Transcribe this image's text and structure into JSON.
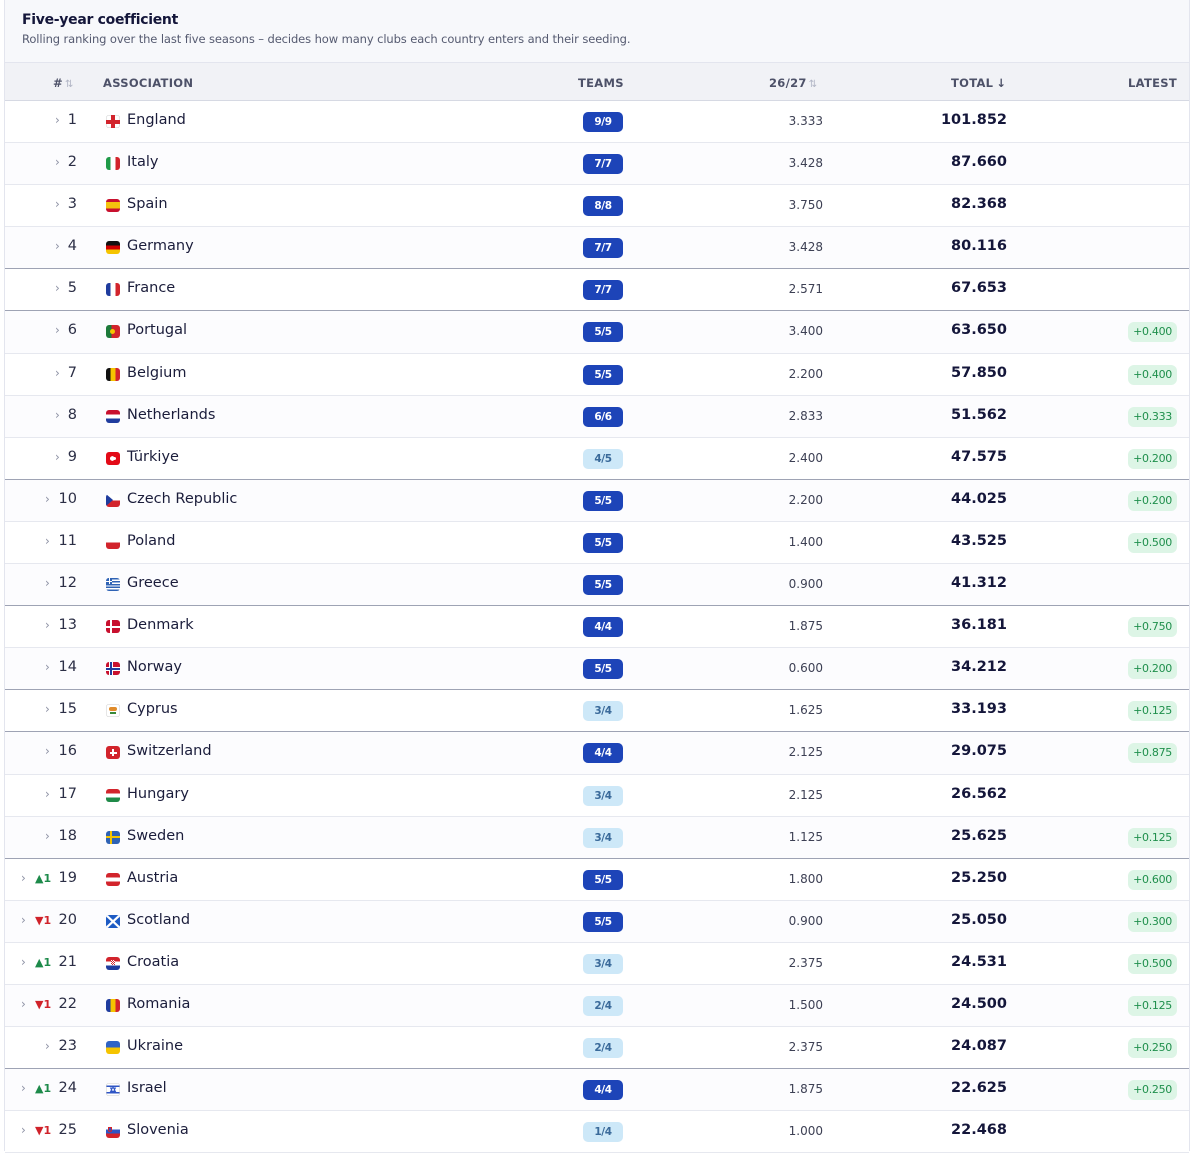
{
  "header": {
    "title": "Five-year coefficient",
    "subtitle": "Rolling ranking over the last five seasons – decides how many clubs each country enters and their seeding."
  },
  "columns": {
    "rank": "#",
    "association": "ASSOCIATION",
    "teams": "TEAMS",
    "season": "26/27",
    "total": "TOTAL",
    "latest": "LATEST"
  },
  "icons": {
    "sort": "sort-icon",
    "sort_desc": "sort-desc-icon",
    "expand": "chevron-right-icon"
  },
  "colors": {
    "teams_full_bg": "#1d44b8",
    "teams_partial_bg": "#cde8f8",
    "latest_bg": "#ddf5e6",
    "latest_text": "#1f8f4c",
    "move_up": "#1d8a4a",
    "move_down": "#d0222a"
  },
  "rows": [
    {
      "rank": "1",
      "move": "",
      "dir": "",
      "name": "England",
      "flag": "england",
      "teams": "9/9",
      "full": true,
      "season": "3.333",
      "total": "101.852",
      "latest": ""
    },
    {
      "rank": "2",
      "move": "",
      "dir": "",
      "name": "Italy",
      "flag": "italy",
      "teams": "7/7",
      "full": true,
      "season": "3.428",
      "total": "87.660",
      "latest": ""
    },
    {
      "rank": "3",
      "move": "",
      "dir": "",
      "name": "Spain",
      "flag": "spain",
      "teams": "8/8",
      "full": true,
      "season": "3.750",
      "total": "82.368",
      "latest": ""
    },
    {
      "rank": "4",
      "move": "",
      "dir": "",
      "name": "Germany",
      "flag": "germany",
      "teams": "7/7",
      "full": true,
      "season": "3.428",
      "total": "80.116",
      "latest": ""
    },
    {
      "rank": "5",
      "move": "",
      "dir": "",
      "name": "France",
      "flag": "france",
      "teams": "7/7",
      "full": true,
      "season": "2.571",
      "total": "67.653",
      "latest": ""
    },
    {
      "rank": "6",
      "move": "",
      "dir": "",
      "name": "Portugal",
      "flag": "portugal",
      "teams": "5/5",
      "full": true,
      "season": "3.400",
      "total": "63.650",
      "latest": "+0.400"
    },
    {
      "rank": "7",
      "move": "",
      "dir": "",
      "name": "Belgium",
      "flag": "belgium",
      "teams": "5/5",
      "full": true,
      "season": "2.200",
      "total": "57.850",
      "latest": "+0.400"
    },
    {
      "rank": "8",
      "move": "",
      "dir": "",
      "name": "Netherlands",
      "flag": "netherlands",
      "teams": "6/6",
      "full": true,
      "season": "2.833",
      "total": "51.562",
      "latest": "+0.333"
    },
    {
      "rank": "9",
      "move": "",
      "dir": "",
      "name": "Türkiye",
      "flag": "turkiye",
      "teams": "4/5",
      "full": false,
      "season": "2.400",
      "total": "47.575",
      "latest": "+0.200"
    },
    {
      "rank": "10",
      "move": "",
      "dir": "",
      "name": "Czech Republic",
      "flag": "czech",
      "teams": "5/5",
      "full": true,
      "season": "2.200",
      "total": "44.025",
      "latest": "+0.200"
    },
    {
      "rank": "11",
      "move": "",
      "dir": "",
      "name": "Poland",
      "flag": "poland",
      "teams": "5/5",
      "full": true,
      "season": "1.400",
      "total": "43.525",
      "latest": "+0.500"
    },
    {
      "rank": "12",
      "move": "",
      "dir": "",
      "name": "Greece",
      "flag": "greece",
      "teams": "5/5",
      "full": true,
      "season": "0.900",
      "total": "41.312",
      "latest": ""
    },
    {
      "rank": "13",
      "move": "",
      "dir": "",
      "name": "Denmark",
      "flag": "denmark",
      "teams": "4/4",
      "full": true,
      "season": "1.875",
      "total": "36.181",
      "latest": "+0.750"
    },
    {
      "rank": "14",
      "move": "",
      "dir": "",
      "name": "Norway",
      "flag": "norway",
      "teams": "5/5",
      "full": true,
      "season": "0.600",
      "total": "34.212",
      "latest": "+0.200"
    },
    {
      "rank": "15",
      "move": "",
      "dir": "",
      "name": "Cyprus",
      "flag": "cyprus",
      "teams": "3/4",
      "full": false,
      "season": "1.625",
      "total": "33.193",
      "latest": "+0.125"
    },
    {
      "rank": "16",
      "move": "",
      "dir": "",
      "name": "Switzerland",
      "flag": "switzerland",
      "teams": "4/4",
      "full": true,
      "season": "2.125",
      "total": "29.075",
      "latest": "+0.875"
    },
    {
      "rank": "17",
      "move": "",
      "dir": "",
      "name": "Hungary",
      "flag": "hungary",
      "teams": "3/4",
      "full": false,
      "season": "2.125",
      "total": "26.562",
      "latest": ""
    },
    {
      "rank": "18",
      "move": "",
      "dir": "",
      "name": "Sweden",
      "flag": "sweden",
      "teams": "3/4",
      "full": false,
      "season": "1.125",
      "total": "25.625",
      "latest": "+0.125"
    },
    {
      "rank": "19",
      "move": "▲1",
      "dir": "up",
      "name": "Austria",
      "flag": "austria",
      "teams": "5/5",
      "full": true,
      "season": "1.800",
      "total": "25.250",
      "latest": "+0.600"
    },
    {
      "rank": "20",
      "move": "▼1",
      "dir": "down",
      "name": "Scotland",
      "flag": "scotland",
      "teams": "5/5",
      "full": true,
      "season": "0.900",
      "total": "25.050",
      "latest": "+0.300"
    },
    {
      "rank": "21",
      "move": "▲1",
      "dir": "up",
      "name": "Croatia",
      "flag": "croatia",
      "teams": "3/4",
      "full": false,
      "season": "2.375",
      "total": "24.531",
      "latest": "+0.500"
    },
    {
      "rank": "22",
      "move": "▼1",
      "dir": "down",
      "name": "Romania",
      "flag": "romania",
      "teams": "2/4",
      "full": false,
      "season": "1.500",
      "total": "24.500",
      "latest": "+0.125"
    },
    {
      "rank": "23",
      "move": "",
      "dir": "",
      "name": "Ukraine",
      "flag": "ukraine",
      "teams": "2/4",
      "full": false,
      "season": "2.375",
      "total": "24.087",
      "latest": "+0.250"
    },
    {
      "rank": "24",
      "move": "▲1",
      "dir": "up",
      "name": "Israel",
      "flag": "israel",
      "teams": "4/4",
      "full": true,
      "season": "1.875",
      "total": "22.625",
      "latest": "+0.250"
    },
    {
      "rank": "25",
      "move": "▼1",
      "dir": "down",
      "name": "Slovenia",
      "flag": "slovenia",
      "teams": "1/4",
      "full": false,
      "season": "1.000",
      "total": "22.468",
      "latest": ""
    }
  ],
  "separators_after_rank": [
    "4",
    "5",
    "9",
    "12",
    "14",
    "15",
    "18",
    "23"
  ]
}
